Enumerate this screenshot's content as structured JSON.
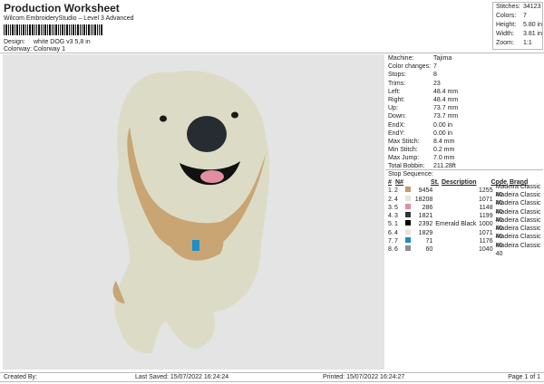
{
  "header": {
    "title": "Production Worksheet",
    "subtitle": "Wilcom EmbroideryStudio – Level 3 Advanced",
    "design_label": "Design:",
    "design": "white DOG v3 5,8 in",
    "colorway_label": "Colorway:",
    "colorway": "Colorway 1"
  },
  "summary": [
    {
      "k": "Stitches:",
      "v": "34123"
    },
    {
      "k": "Colors:",
      "v": "7"
    },
    {
      "k": "Height:",
      "v": "5.80 in"
    },
    {
      "k": "Width:",
      "v": "3.81 in"
    },
    {
      "k": "Zoom:",
      "v": "1:1"
    }
  ],
  "info": [
    {
      "k": "Machine:",
      "v": "Tajima"
    },
    {
      "k": "Color changes:",
      "v": "7"
    },
    {
      "k": "Stops:",
      "v": "8"
    },
    {
      "k": "Trims:",
      "v": "23"
    },
    {
      "k": "Left:",
      "v": "48.4 mm"
    },
    {
      "k": "Right:",
      "v": "48.4 mm"
    },
    {
      "k": "Up:",
      "v": "73.7 mm"
    },
    {
      "k": "Down:",
      "v": "73.7 mm"
    },
    {
      "k": "EndX:",
      "v": "0.00 in"
    },
    {
      "k": "EndY:",
      "v": "0.00 in"
    },
    {
      "k": "Max Stitch:",
      "v": "8.4 mm"
    },
    {
      "k": "Min Stitch:",
      "v": "0.2 mm"
    },
    {
      "k": "Max Jump:",
      "v": "7.0 mm"
    },
    {
      "k": "Total Bobbin:",
      "v": "211.28ft"
    }
  ],
  "stops": {
    "title": "Stop Sequence:",
    "headers": [
      "#",
      "N#",
      "St.",
      "Description",
      "Code",
      "Brand"
    ],
    "rows": [
      {
        "n": "1.",
        "nn": "2",
        "color": "#c59a6c",
        "st": "9454",
        "desc": "",
        "code": "1255",
        "brand": "Madeira Classic 40"
      },
      {
        "n": "2.",
        "nn": "4",
        "color": "#e8e4da",
        "st": "18208",
        "desc": "",
        "code": "1071",
        "brand": "Madeira Classic 40"
      },
      {
        "n": "3.",
        "nn": "5",
        "color": "#e08ea0",
        "st": "286",
        "desc": "",
        "code": "1148",
        "brand": "Madeira Classic 40"
      },
      {
        "n": "4.",
        "nn": "3",
        "color": "#2e3640",
        "st": "1821",
        "desc": "",
        "code": "1199",
        "brand": "Madeira Classic 40"
      },
      {
        "n": "5.",
        "nn": "1",
        "color": "#000000",
        "st": "2392",
        "desc": "Emerald Black",
        "code": "1000",
        "brand": "Madeira Classic 40"
      },
      {
        "n": "6.",
        "nn": "4",
        "color": "#e8e4da",
        "st": "1829",
        "desc": "",
        "code": "1071",
        "brand": "Madeira Classic 40"
      },
      {
        "n": "7.",
        "nn": "7",
        "color": "#1e8ec8",
        "st": "71",
        "desc": "",
        "code": "1176",
        "brand": "Madeira Classic 40"
      },
      {
        "n": "8.",
        "nn": "6",
        "color": "#8e8e8e",
        "st": "60",
        "desc": "",
        "code": "1040",
        "brand": "Madeira Classic 40"
      }
    ]
  },
  "footer": {
    "created": "Created By:",
    "saved": "Last Saved: 15/07/2022 16:24:24",
    "printed": "Printed: 15/07/2022 16:24:27",
    "page": "Page 1 of 1"
  }
}
